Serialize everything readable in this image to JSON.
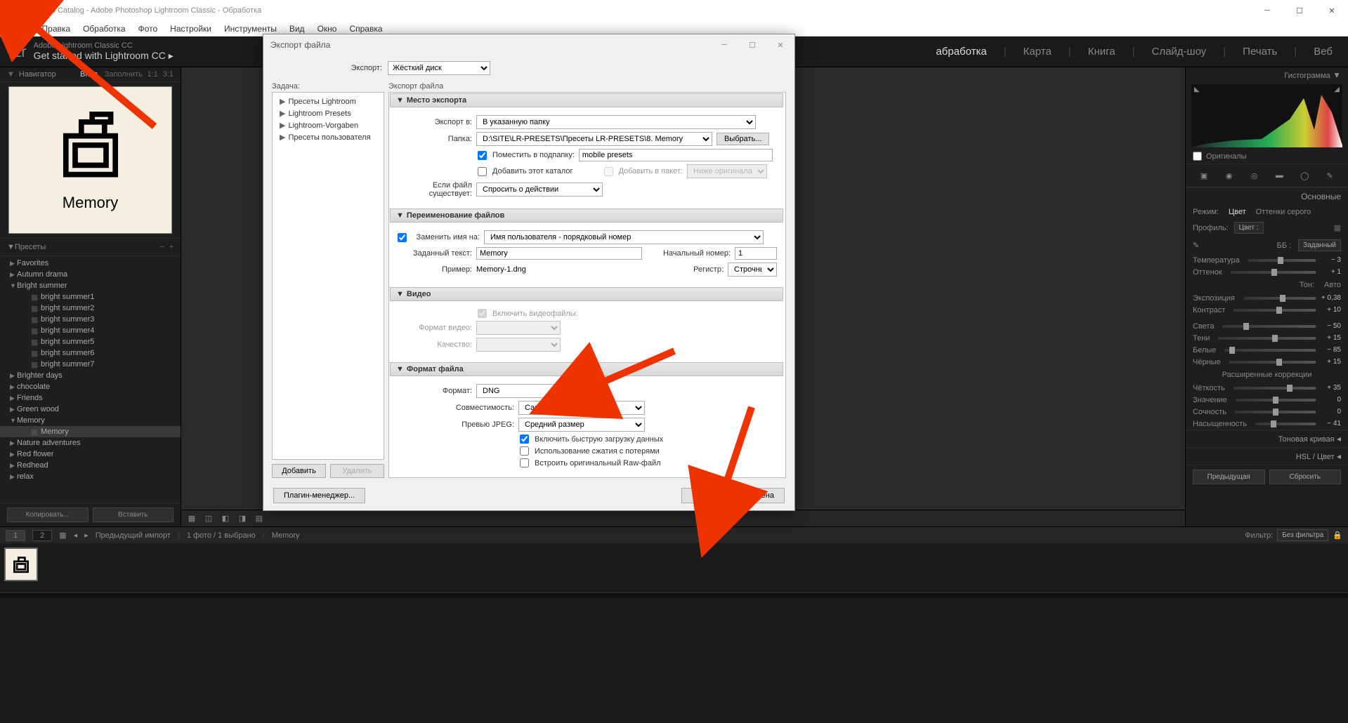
{
  "window": {
    "title": "Lightroom Catalog - Adobe Photoshop Lightroom Classic - Обработка"
  },
  "menu": [
    "Файл",
    "Правка",
    "Обработка",
    "Фото",
    "Настройки",
    "Инструменты",
    "Вид",
    "Окно",
    "Справка"
  ],
  "branding": {
    "logo": "Lr",
    "sub1": "Adobe Lightroom Classic CC",
    "sub2": "Get started with Lightroom CC ▸"
  },
  "modules": [
    "абработка",
    "Карта",
    "Книга",
    "Слайд-шоу",
    "Печать",
    "Веб"
  ],
  "navigator": {
    "title": "Навигатор",
    "opts": [
      "Впис.",
      "Заполнить",
      "1:1",
      "3:1"
    ],
    "thumb_label": "Memory"
  },
  "presets": {
    "title": "Пресеты",
    "folders": [
      {
        "n": "Favorites",
        "open": false
      },
      {
        "n": "Autumn drama",
        "open": false
      },
      {
        "n": "Bright summer",
        "open": true,
        "children": [
          "bright summer1",
          "bright summer2",
          "bright summer3",
          "bright summer4",
          "bright summer5",
          "bright summer6",
          "bright summer7"
        ]
      },
      {
        "n": "Brighter days",
        "open": false
      },
      {
        "n": "chocolate",
        "open": false
      },
      {
        "n": "Friends",
        "open": false
      },
      {
        "n": "Green wood",
        "open": false
      },
      {
        "n": "Memory",
        "open": true,
        "children_sel": [
          "Memory"
        ]
      },
      {
        "n": "Nature adventures",
        "open": false
      },
      {
        "n": "Red flower",
        "open": false
      },
      {
        "n": "Redhead",
        "open": false
      },
      {
        "n": "relax",
        "open": false
      }
    ],
    "btn_copy": "Копировать...",
    "btn_paste": "Вставить"
  },
  "right": {
    "histogram": "Гистограмма",
    "originals": "Оригиналы",
    "basic": "Основные",
    "mode": {
      "label": "Режим:",
      "color": "Цвет",
      "bw": "Оттенки серого"
    },
    "profile": {
      "label": "Профиль:",
      "value": "Цвет :"
    },
    "wb": {
      "label": "ББ :",
      "value": "Заданный"
    },
    "sliders": [
      {
        "l": "Температура",
        "v": "− 3",
        "p": 48
      },
      {
        "l": "Оттенок",
        "v": "+ 1",
        "p": 51
      }
    ],
    "tone_label": "Тон:",
    "tone_auto": "Авто",
    "tone": [
      {
        "l": "Экспозиция",
        "v": "+ 0,38",
        "p": 54
      },
      {
        "l": "Контраст",
        "v": "+ 10",
        "p": 55
      }
    ],
    "tone2": [
      {
        "l": "Света",
        "v": "− 50",
        "p": 25
      },
      {
        "l": "Тени",
        "v": "+ 15",
        "p": 58
      },
      {
        "l": "Белые",
        "v": "− 85",
        "p": 8
      },
      {
        "l": "Чёрные",
        "v": "+ 15",
        "p": 58
      }
    ],
    "presence_label": "Расширенные коррекции",
    "presence": [
      {
        "l": "Чёткость",
        "v": "+ 35",
        "p": 68
      },
      {
        "l": "Значение",
        "v": "0",
        "p": 50
      },
      {
        "l": "Сочность",
        "v": "0",
        "p": 50
      },
      {
        "l": "Насыщенность",
        "v": "− 41",
        "p": 30
      }
    ],
    "tone_curve": "Тоновая кривая",
    "hsl": "HSL / Цвет",
    "btn_prev": "Предыдущая",
    "btn_reset": "Сбросить"
  },
  "film": {
    "prev_import": "Предыдущий импорт",
    "count": "1 фото  /  1 выбрано",
    "path": "Memory",
    "filter": "Фильтр:",
    "filter_val": "Без фильтра"
  },
  "dialog": {
    "title": "Экспорт файла",
    "export_lbl": "Экспорт:",
    "export_val": "Жёсткий диск",
    "task": "Задача:",
    "right_hd": "Экспорт файла",
    "presets": [
      "Пресеты Lightroom",
      "Lightroom Presets",
      "Lightroom-Vorgaben",
      "Пресеты пользователя"
    ],
    "btn_add": "Добавить",
    "btn_del": "Удалить",
    "s1": {
      "title": "Место экспорта",
      "export_to": "Экспорт в:",
      "export_to_v": "В указанную папку",
      "folder": "Папка:",
      "folder_v": "D:\\SITE\\LR-PRESETS\\Пресеты LR-PRESETS\\8. Memory",
      "choose": "Выбрать...",
      "subfolder": "Поместить в подпапку:",
      "subfolder_v": "mobile presets",
      "add_catalog": "Добавить этот каталог",
      "add_stack": "Добавить в пакет:",
      "stack_v": "Ниже оригинала",
      "exists": "Если файл существует:",
      "exists_v": "Спросить о действии"
    },
    "s2": {
      "title": "Переименование файлов",
      "replace": "Заменить имя на:",
      "replace_v": "Имя пользователя - порядковый номер",
      "custom": "Заданный текст:",
      "custom_v": "Memory",
      "start": "Начальный номер:",
      "start_v": "1",
      "example": "Пример:",
      "example_v": "Memory-1.dng",
      "case": "Регистр:",
      "case_v": "Строчные"
    },
    "s3": {
      "title": "Видео",
      "include": "Включить видеофайлы:",
      "vformat": "Формат видео:",
      "quality": "Качество:"
    },
    "s4": {
      "title": "Формат файла",
      "format": "Формат:",
      "format_v": "DNG",
      "compat": "Совместимость:",
      "compat_v": "Camera Raw 7.1 и более",
      "preview": "Превью JPEG:",
      "preview_v": "Средний размер",
      "fast": "Включить быструю загрузку данных",
      "lossy": "Использование сжатия с потерями",
      "embed": "Встроить оригинальный Raw-файл"
    },
    "plugin": "Плагин-менеджер...",
    "export": "Экспорт",
    "cancel": "Отмена"
  }
}
